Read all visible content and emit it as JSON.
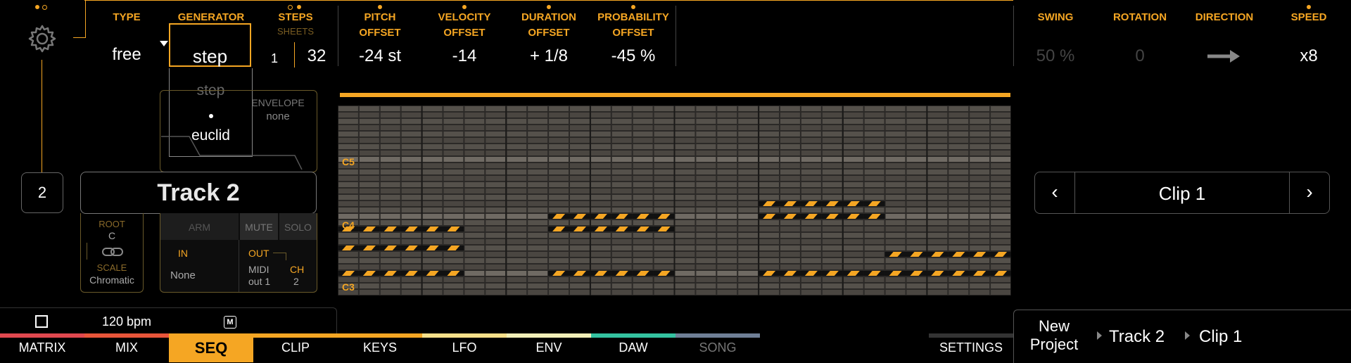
{
  "header": {
    "type": {
      "label": "TYPE",
      "value": "free"
    },
    "generator": {
      "label": "GENERATOR",
      "value": "step"
    },
    "steps": {
      "label": "STEPS",
      "sheets_label": "SHEETS",
      "sheets_value": "1",
      "value": "32"
    },
    "pitch_offset": {
      "label": "PITCH\nOFFSET",
      "value": "-24 st"
    },
    "velocity_offset": {
      "label": "VELOCITY\nOFFSET",
      "value": "-14"
    },
    "duration_offset": {
      "label": "DURATION\nOFFSET",
      "value": "+ 1/8"
    },
    "probability_offset": {
      "label": "PROBABILITY\nOFFSET",
      "value": "-45 %"
    },
    "swing": {
      "label": "SWING",
      "value": "50 %"
    },
    "rotation": {
      "label": "ROTATION",
      "value": "0"
    },
    "direction": {
      "label": "DIRECTION",
      "icon": "arrow-right-icon"
    },
    "speed": {
      "label": "SPEED",
      "value": "x8"
    }
  },
  "generator_dropdown": {
    "options": [
      "step",
      "euclid"
    ]
  },
  "track": {
    "number": "2",
    "name": "Track 2",
    "envelope_label": "ENVELOPE",
    "envelope_value": "none"
  },
  "scale_panel": {
    "root_label": "ROOT",
    "root_value": "C",
    "scale_label": "SCALE",
    "scale_value": "Chromatic"
  },
  "routing": {
    "arm": "ARM",
    "mute": "MUTE",
    "solo": "SOLO",
    "in_label": "IN",
    "in_value": "None",
    "out_label": "OUT",
    "out_value": "MIDI\nout 1",
    "ch_label": "CH",
    "ch_value": "2"
  },
  "grid": {
    "note_labels": [
      "C5",
      "C4",
      "C3"
    ]
  },
  "clip_selector": {
    "name": "Clip 1",
    "prev": "‹",
    "next": "›"
  },
  "transport": {
    "bpm": "120 bpm",
    "metronome": "M"
  },
  "tabs": [
    {
      "label": "MATRIX",
      "color": "#e0484f"
    },
    {
      "label": "MIX",
      "color": "#e8553a"
    },
    {
      "label": "SEQ",
      "color": "#f5a623"
    },
    {
      "label": "CLIP",
      "color": "#f5a623"
    },
    {
      "label": "KEYS",
      "color": "#f5a623"
    },
    {
      "label": "LFO",
      "color": "#f7e08a"
    },
    {
      "label": "ENV",
      "color": "#f2f0b8"
    },
    {
      "label": "DAW",
      "color": "#34c2a0"
    },
    {
      "label": "SONG",
      "color": "#6f7f96"
    }
  ],
  "settings_label": "SETTINGS",
  "breadcrumb": {
    "project": "New\nProject",
    "track": "Track 2",
    "clip": "Clip 1"
  },
  "colors": {
    "accent": "#f5a623",
    "background": "#000000"
  }
}
